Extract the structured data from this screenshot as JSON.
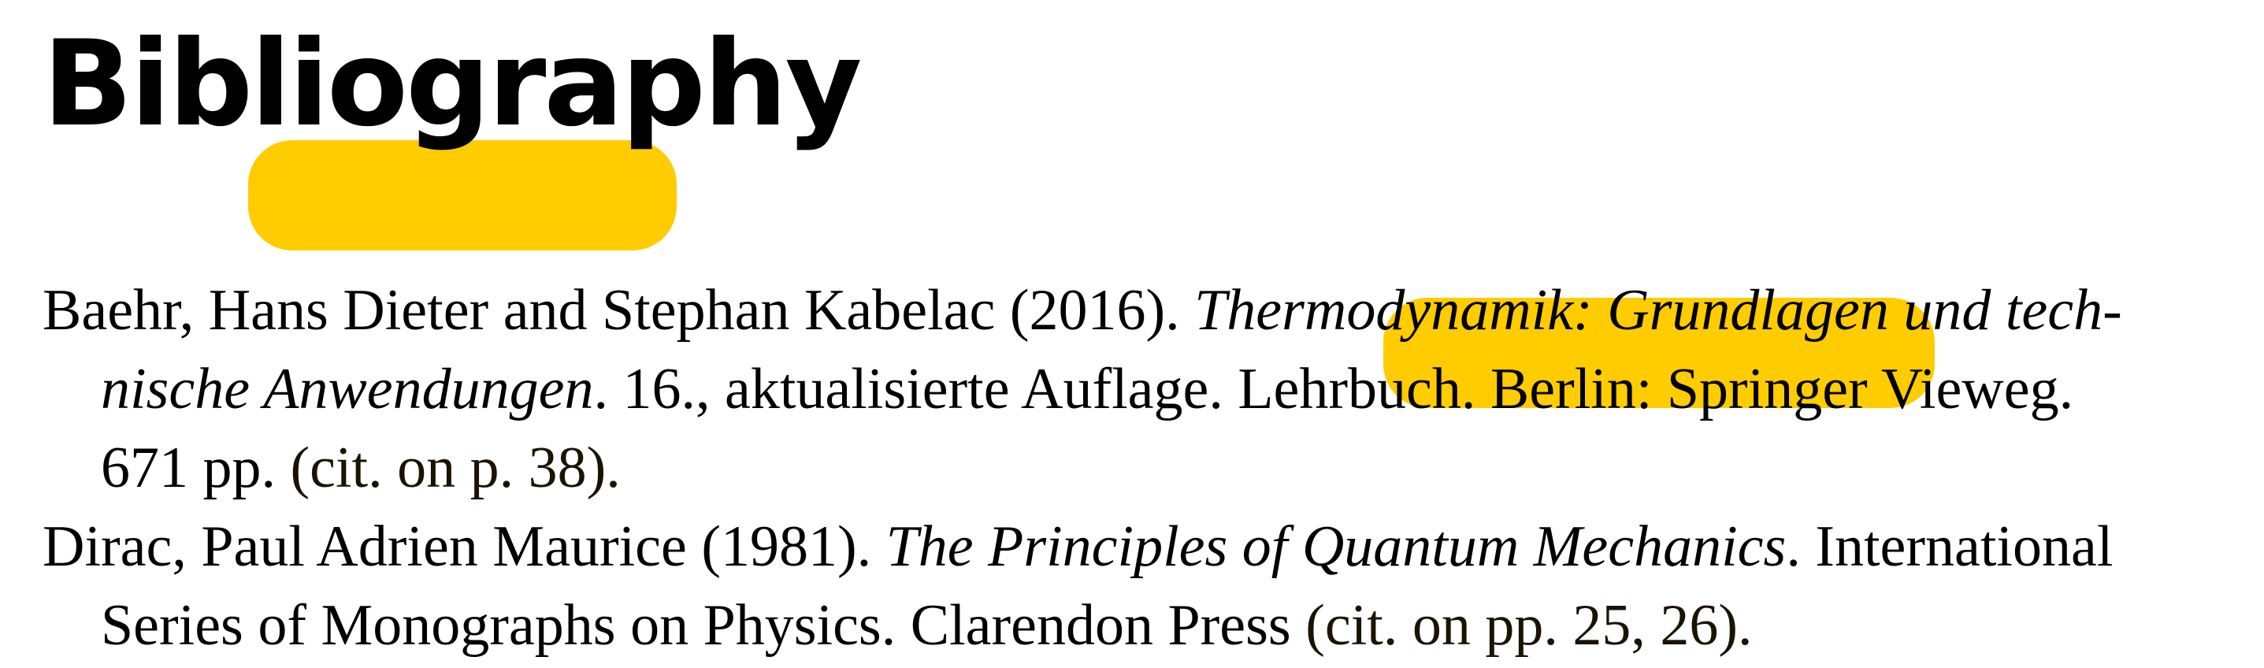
{
  "heading": "Bibliography",
  "entries": [
    {
      "line1_a": "Baehr, Hans Dieter and Stephan Kabelac (2016). ",
      "line1_b": "Thermodynamik: Grundlagen und tech-",
      "line2_a": "nische Anwendungen",
      "line2_b": ". 16., aktualisierte Auflage. Lehrbuch. Berlin: Springer Vieweg.",
      "line3_a": "671 pp. ",
      "citation": "(cit. on p. 38)."
    },
    {
      "line1_a": "Dirac, Paul Adrien Maurice (1981). ",
      "line1_b": "The Principles of Quantum Mechanics",
      "line1_c": ". International",
      "line2_a": "Series of Monographs on Physics. Clarendon Press ",
      "citation": "(cit. on pp. 25, 26)."
    }
  ],
  "colors": {
    "highlight": "#ffcc00",
    "text": "#000000",
    "background": "#ffffff"
  }
}
